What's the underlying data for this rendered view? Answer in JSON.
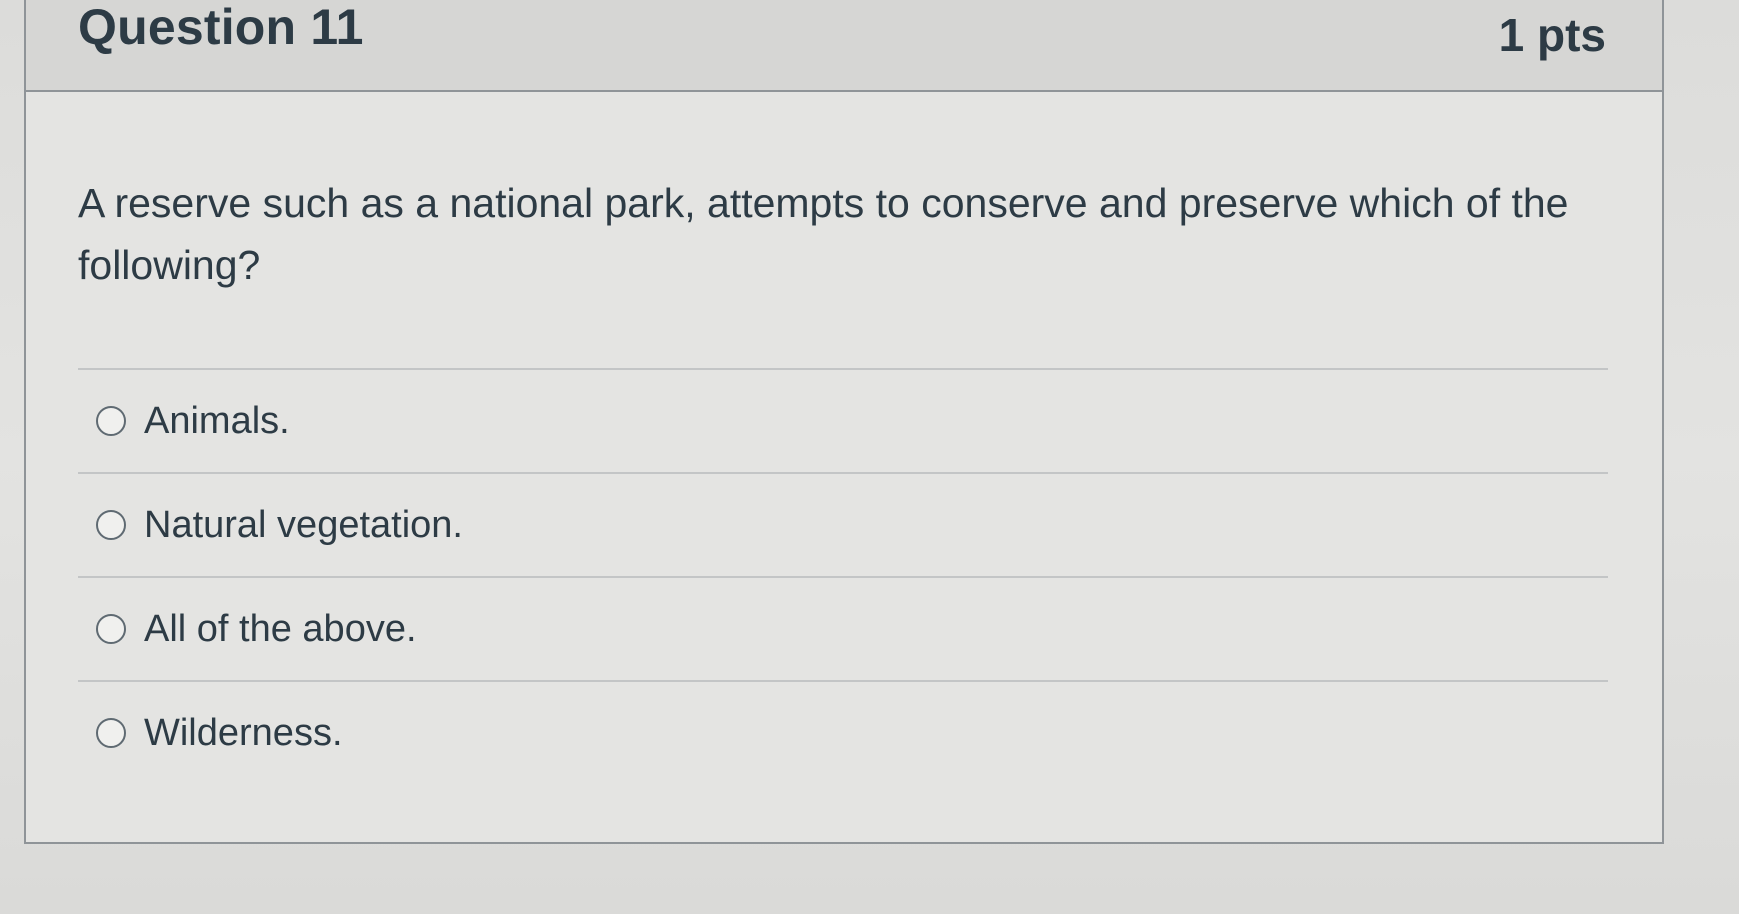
{
  "question": {
    "title": "Question 11",
    "points": "1 pts",
    "text": "A reserve such as a national park, attempts to conserve and preserve which of the following?",
    "answers": [
      {
        "label": "Animals."
      },
      {
        "label": "Natural vegetation."
      },
      {
        "label": "All of the above."
      },
      {
        "label": "Wilderness."
      }
    ]
  }
}
